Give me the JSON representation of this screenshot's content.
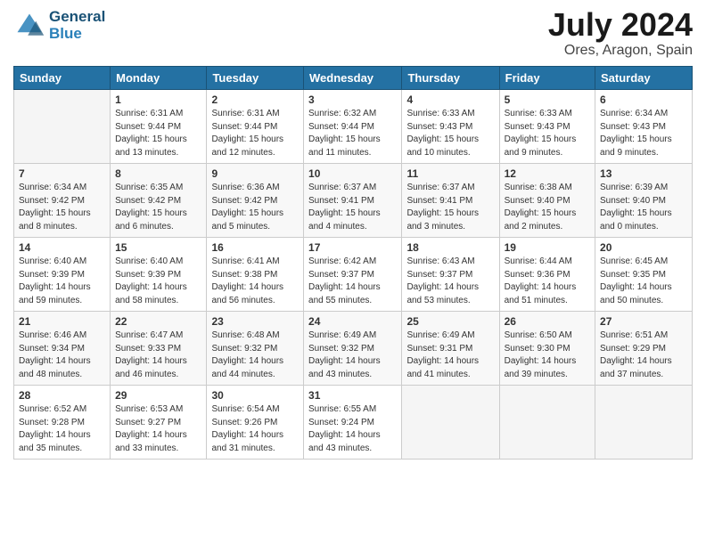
{
  "logo": {
    "line1": "General",
    "line2": "Blue"
  },
  "title": "July 2024",
  "location": "Ores, Aragon, Spain",
  "weekdays": [
    "Sunday",
    "Monday",
    "Tuesday",
    "Wednesday",
    "Thursday",
    "Friday",
    "Saturday"
  ],
  "weeks": [
    [
      {
        "day": "",
        "sunrise": "",
        "sunset": "",
        "daylight": ""
      },
      {
        "day": "1",
        "sunrise": "Sunrise: 6:31 AM",
        "sunset": "Sunset: 9:44 PM",
        "daylight": "Daylight: 15 hours and 13 minutes."
      },
      {
        "day": "2",
        "sunrise": "Sunrise: 6:31 AM",
        "sunset": "Sunset: 9:44 PM",
        "daylight": "Daylight: 15 hours and 12 minutes."
      },
      {
        "day": "3",
        "sunrise": "Sunrise: 6:32 AM",
        "sunset": "Sunset: 9:44 PM",
        "daylight": "Daylight: 15 hours and 11 minutes."
      },
      {
        "day": "4",
        "sunrise": "Sunrise: 6:33 AM",
        "sunset": "Sunset: 9:43 PM",
        "daylight": "Daylight: 15 hours and 10 minutes."
      },
      {
        "day": "5",
        "sunrise": "Sunrise: 6:33 AM",
        "sunset": "Sunset: 9:43 PM",
        "daylight": "Daylight: 15 hours and 9 minutes."
      },
      {
        "day": "6",
        "sunrise": "Sunrise: 6:34 AM",
        "sunset": "Sunset: 9:43 PM",
        "daylight": "Daylight: 15 hours and 9 minutes."
      }
    ],
    [
      {
        "day": "7",
        "sunrise": "Sunrise: 6:34 AM",
        "sunset": "Sunset: 9:42 PM",
        "daylight": "Daylight: 15 hours and 8 minutes."
      },
      {
        "day": "8",
        "sunrise": "Sunrise: 6:35 AM",
        "sunset": "Sunset: 9:42 PM",
        "daylight": "Daylight: 15 hours and 6 minutes."
      },
      {
        "day": "9",
        "sunrise": "Sunrise: 6:36 AM",
        "sunset": "Sunset: 9:42 PM",
        "daylight": "Daylight: 15 hours and 5 minutes."
      },
      {
        "day": "10",
        "sunrise": "Sunrise: 6:37 AM",
        "sunset": "Sunset: 9:41 PM",
        "daylight": "Daylight: 15 hours and 4 minutes."
      },
      {
        "day": "11",
        "sunrise": "Sunrise: 6:37 AM",
        "sunset": "Sunset: 9:41 PM",
        "daylight": "Daylight: 15 hours and 3 minutes."
      },
      {
        "day": "12",
        "sunrise": "Sunrise: 6:38 AM",
        "sunset": "Sunset: 9:40 PM",
        "daylight": "Daylight: 15 hours and 2 minutes."
      },
      {
        "day": "13",
        "sunrise": "Sunrise: 6:39 AM",
        "sunset": "Sunset: 9:40 PM",
        "daylight": "Daylight: 15 hours and 0 minutes."
      }
    ],
    [
      {
        "day": "14",
        "sunrise": "Sunrise: 6:40 AM",
        "sunset": "Sunset: 9:39 PM",
        "daylight": "Daylight: 14 hours and 59 minutes."
      },
      {
        "day": "15",
        "sunrise": "Sunrise: 6:40 AM",
        "sunset": "Sunset: 9:39 PM",
        "daylight": "Daylight: 14 hours and 58 minutes."
      },
      {
        "day": "16",
        "sunrise": "Sunrise: 6:41 AM",
        "sunset": "Sunset: 9:38 PM",
        "daylight": "Daylight: 14 hours and 56 minutes."
      },
      {
        "day": "17",
        "sunrise": "Sunrise: 6:42 AM",
        "sunset": "Sunset: 9:37 PM",
        "daylight": "Daylight: 14 hours and 55 minutes."
      },
      {
        "day": "18",
        "sunrise": "Sunrise: 6:43 AM",
        "sunset": "Sunset: 9:37 PM",
        "daylight": "Daylight: 14 hours and 53 minutes."
      },
      {
        "day": "19",
        "sunrise": "Sunrise: 6:44 AM",
        "sunset": "Sunset: 9:36 PM",
        "daylight": "Daylight: 14 hours and 51 minutes."
      },
      {
        "day": "20",
        "sunrise": "Sunrise: 6:45 AM",
        "sunset": "Sunset: 9:35 PM",
        "daylight": "Daylight: 14 hours and 50 minutes."
      }
    ],
    [
      {
        "day": "21",
        "sunrise": "Sunrise: 6:46 AM",
        "sunset": "Sunset: 9:34 PM",
        "daylight": "Daylight: 14 hours and 48 minutes."
      },
      {
        "day": "22",
        "sunrise": "Sunrise: 6:47 AM",
        "sunset": "Sunset: 9:33 PM",
        "daylight": "Daylight: 14 hours and 46 minutes."
      },
      {
        "day": "23",
        "sunrise": "Sunrise: 6:48 AM",
        "sunset": "Sunset: 9:32 PM",
        "daylight": "Daylight: 14 hours and 44 minutes."
      },
      {
        "day": "24",
        "sunrise": "Sunrise: 6:49 AM",
        "sunset": "Sunset: 9:32 PM",
        "daylight": "Daylight: 14 hours and 43 minutes."
      },
      {
        "day": "25",
        "sunrise": "Sunrise: 6:49 AM",
        "sunset": "Sunset: 9:31 PM",
        "daylight": "Daylight: 14 hours and 41 minutes."
      },
      {
        "day": "26",
        "sunrise": "Sunrise: 6:50 AM",
        "sunset": "Sunset: 9:30 PM",
        "daylight": "Daylight: 14 hours and 39 minutes."
      },
      {
        "day": "27",
        "sunrise": "Sunrise: 6:51 AM",
        "sunset": "Sunset: 9:29 PM",
        "daylight": "Daylight: 14 hours and 37 minutes."
      }
    ],
    [
      {
        "day": "28",
        "sunrise": "Sunrise: 6:52 AM",
        "sunset": "Sunset: 9:28 PM",
        "daylight": "Daylight: 14 hours and 35 minutes."
      },
      {
        "day": "29",
        "sunrise": "Sunrise: 6:53 AM",
        "sunset": "Sunset: 9:27 PM",
        "daylight": "Daylight: 14 hours and 33 minutes."
      },
      {
        "day": "30",
        "sunrise": "Sunrise: 6:54 AM",
        "sunset": "Sunset: 9:26 PM",
        "daylight": "Daylight: 14 hours and 31 minutes."
      },
      {
        "day": "31",
        "sunrise": "Sunrise: 6:55 AM",
        "sunset": "Sunset: 9:24 PM",
        "daylight": "Daylight: 14 hours and 43 minutes."
      },
      {
        "day": "",
        "sunrise": "",
        "sunset": "",
        "daylight": ""
      },
      {
        "day": "",
        "sunrise": "",
        "sunset": "",
        "daylight": ""
      },
      {
        "day": "",
        "sunrise": "",
        "sunset": "",
        "daylight": ""
      }
    ]
  ]
}
